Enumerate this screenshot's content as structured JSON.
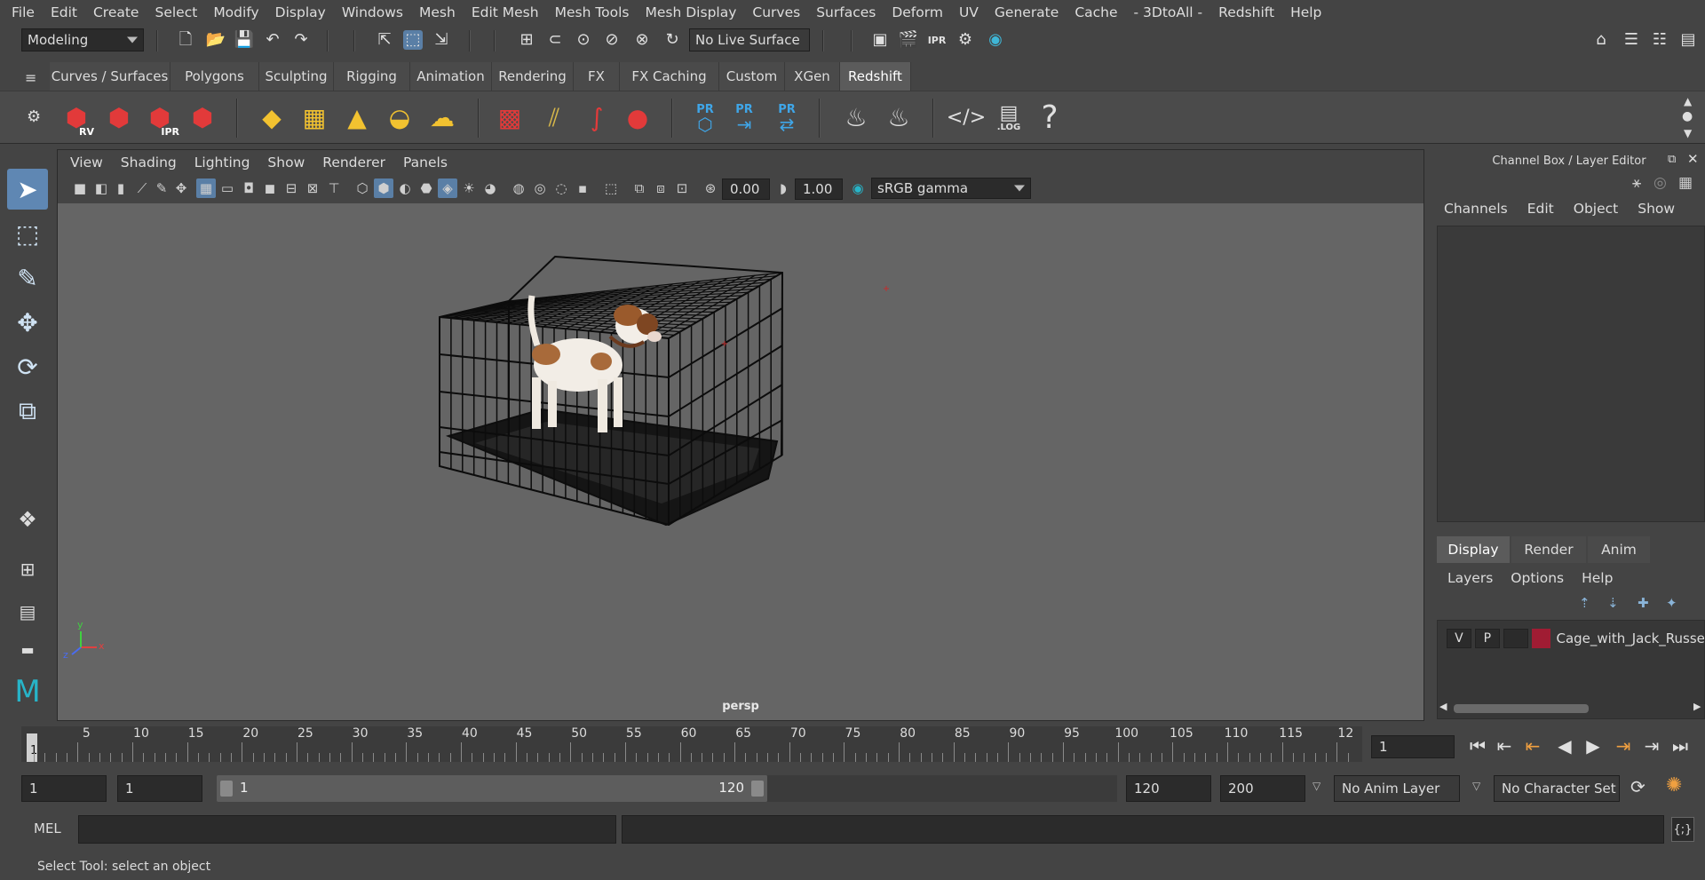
{
  "menubar": [
    "File",
    "Edit",
    "Create",
    "Select",
    "Modify",
    "Display",
    "Windows",
    "Mesh",
    "Edit Mesh",
    "Mesh Tools",
    "Mesh Display",
    "Curves",
    "Surfaces",
    "Deform",
    "UV",
    "Generate",
    "Cache",
    "- 3DtoAll -",
    "Redshift",
    "Help"
  ],
  "statusline": {
    "mode": "Modeling",
    "live_surface": "No Live Surface"
  },
  "shelf": {
    "tabs": [
      "Curves / Surfaces",
      "Polygons",
      "Sculpting",
      "Rigging",
      "Animation",
      "Rendering",
      "FX",
      "FX Caching",
      "Custom",
      "XGen",
      "Redshift"
    ],
    "active_tab": "Redshift",
    "labels": {
      "rv": "RV",
      "ipr": "IPR",
      "pr": "PR",
      "log": ".LOG",
      "help": "?"
    }
  },
  "viewport": {
    "menu": [
      "View",
      "Shading",
      "Lighting",
      "Show",
      "Renderer",
      "Panels"
    ],
    "exposure": "0.00",
    "gamma": "1.00",
    "color_space": "sRGB gamma",
    "camera": "persp",
    "axis": {
      "x": "x",
      "y": "y",
      "z": "z"
    }
  },
  "right_panel": {
    "title": "Channel Box / Layer Editor",
    "cb_menu": [
      "Channels",
      "Edit",
      "Object",
      "Show"
    ],
    "le_tabs": [
      "Display",
      "Render",
      "Anim"
    ],
    "le_menu": [
      "Layers",
      "Options",
      "Help"
    ],
    "layer": {
      "v": "V",
      "p": "P",
      "name": "Cage_with_Jack_Russe",
      "color": "#a01c33"
    }
  },
  "timeline": {
    "ticks": [
      "5",
      "10",
      "15",
      "20",
      "25",
      "30",
      "35",
      "40",
      "45",
      "50",
      "55",
      "60",
      "65",
      "70",
      "75",
      "80",
      "85",
      "90",
      "95",
      "100",
      "105",
      "110",
      "115",
      "12"
    ],
    "playhead_label": "1",
    "current_frame": "1"
  },
  "range": {
    "start": "1",
    "playback_start": "1",
    "slider_start": "1",
    "slider_end": "120",
    "playback_end": "120",
    "end": "200",
    "anim_layer": "No Anim Layer",
    "character_set": "No Character Set"
  },
  "commandline": {
    "label": "MEL"
  },
  "helpline": "Select Tool: select an object"
}
